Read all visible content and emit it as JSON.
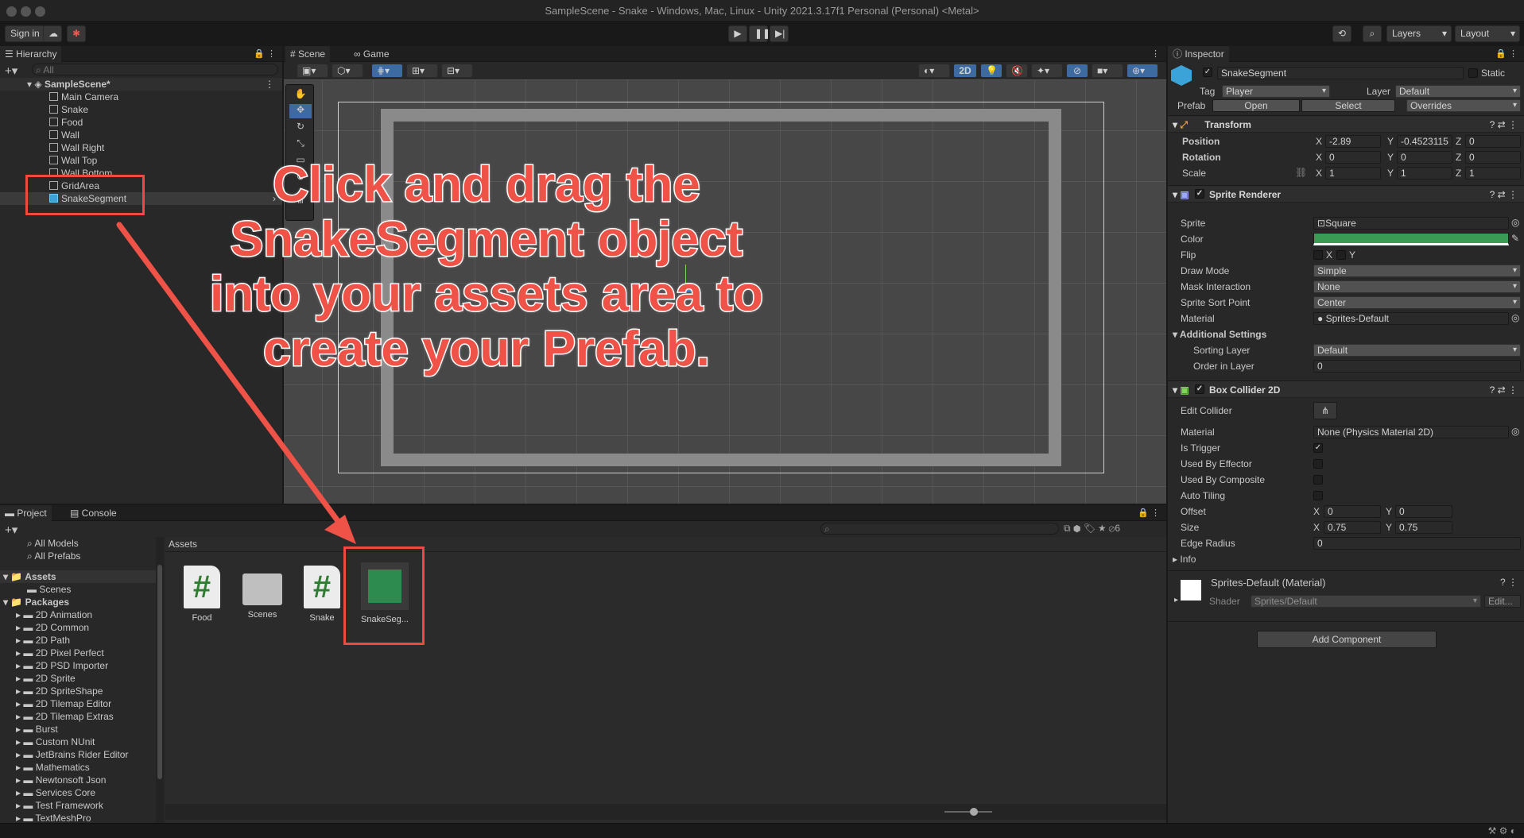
{
  "window": {
    "title": "SampleScene - Snake - Windows, Mac, Linux - Unity 2021.3.17f1 Personal (Personal) <Metal>"
  },
  "toolbar": {
    "sign_in": "Sign in",
    "layers": "Layers",
    "layout": "Layout"
  },
  "hierarchy": {
    "tab": "Hierarchy",
    "search_placeholder": "All",
    "scene": "SampleScene*",
    "items": [
      "Main Camera",
      "Snake",
      "Food",
      "Wall",
      "Wall Right",
      "Wall Top",
      "Wall Bottom",
      "GridArea",
      "SnakeSegment"
    ]
  },
  "scene_view": {
    "tab_scene": "Scene",
    "tab_game": "Game",
    "mode_2d": "2D"
  },
  "annotation": {
    "lines": [
      "Click and drag the",
      "SnakeSegment object",
      "into your assets area to",
      "create your Prefab."
    ],
    "color": "#ef5247"
  },
  "project": {
    "tab_project": "Project",
    "tab_console": "Console",
    "hidden_count": "6",
    "breadcrumb": "Assets",
    "favorites": [
      "All Models",
      "All Prefabs"
    ],
    "assets_root": "Assets",
    "assets_children": [
      "Scenes"
    ],
    "packages_root": "Packages",
    "packages": [
      "2D Animation",
      "2D Common",
      "2D Path",
      "2D Pixel Perfect",
      "2D PSD Importer",
      "2D Sprite",
      "2D SpriteShape",
      "2D Tilemap Editor",
      "2D Tilemap Extras",
      "Burst",
      "Custom NUnit",
      "JetBrains Rider Editor",
      "Mathematics",
      "Newtonsoft Json",
      "Services Core",
      "Test Framework",
      "TextMeshPro"
    ],
    "grid_items": [
      {
        "name": "Food",
        "icon": "script-icon"
      },
      {
        "name": "Scenes",
        "icon": "folder-icon"
      },
      {
        "name": "Snake",
        "icon": "script-icon"
      },
      {
        "name": "SnakeSeg...",
        "icon": "prefab-icon"
      }
    ]
  },
  "inspector": {
    "tab": "Inspector",
    "object_name": "SnakeSegment",
    "static_label": "Static",
    "tag_label": "Tag",
    "tag_value": "Player",
    "layer_label": "Layer",
    "layer_value": "Default",
    "prefab_label": "Prefab",
    "open": "Open",
    "select": "Select",
    "overrides": "Overrides",
    "transform": {
      "title": "Transform",
      "position": {
        "label": "Position",
        "x": "-2.89",
        "y": "-0.4523115",
        "z": "0"
      },
      "rotation": {
        "label": "Rotation",
        "x": "0",
        "y": "0",
        "z": "0"
      },
      "scale": {
        "label": "Scale",
        "x": "1",
        "y": "1",
        "z": "1"
      }
    },
    "sprite_renderer": {
      "title": "Sprite Renderer",
      "sprite_label": "Sprite",
      "sprite_value": "Square",
      "color_label": "Color",
      "color_value": "#3a9b55",
      "flip_label": "Flip",
      "flip_x": "X",
      "flip_y": "Y",
      "draw_mode_label": "Draw Mode",
      "draw_mode_value": "Simple",
      "mask_label": "Mask Interaction",
      "mask_value": "None",
      "sort_point_label": "Sprite Sort Point",
      "sort_point_value": "Center",
      "material_label": "Material",
      "material_value": "Sprites-Default",
      "additional": "Additional Settings",
      "sorting_layer_label": "Sorting Layer",
      "sorting_layer_value": "Default",
      "order_label": "Order in Layer",
      "order_value": "0"
    },
    "box_collider": {
      "title": "Box Collider 2D",
      "edit_label": "Edit Collider",
      "material_label": "Material",
      "material_value": "None (Physics Material 2D)",
      "is_trigger": "Is Trigger",
      "used_by_effector": "Used By Effector",
      "used_by_composite": "Used By Composite",
      "auto_tiling": "Auto Tiling",
      "offset_label": "Offset",
      "offset_x": "0",
      "offset_y": "0",
      "size_label": "Size",
      "size_x": "0.75",
      "size_y": "0.75",
      "edge_label": "Edge Radius",
      "edge_value": "0",
      "info": "Info"
    },
    "material": {
      "title": "Sprites-Default (Material)",
      "shader_label": "Shader",
      "shader_value": "Sprites/Default",
      "edit": "Edit..."
    },
    "add_component": "Add Component"
  }
}
